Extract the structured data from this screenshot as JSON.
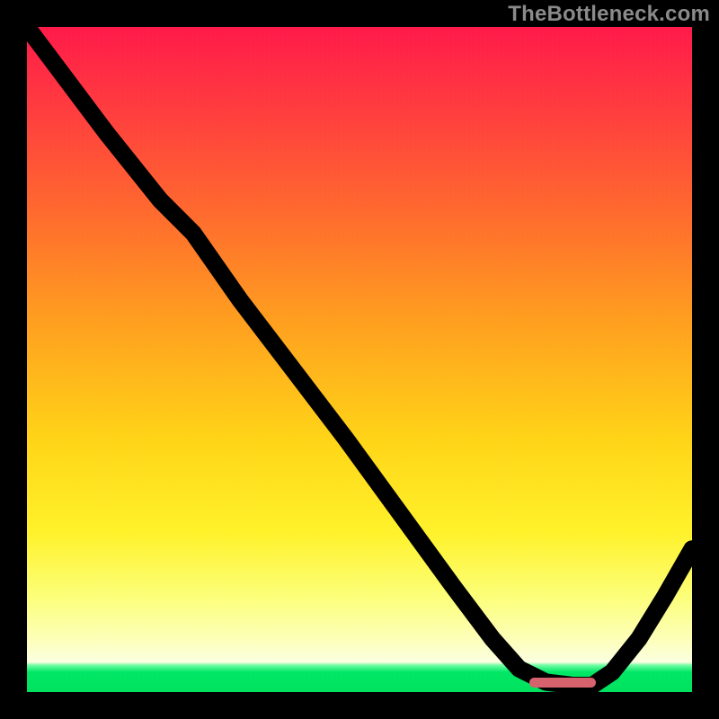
{
  "watermark": "TheBottleneck.com",
  "chart_data": {
    "type": "line",
    "title": "",
    "xlabel": "",
    "ylabel": "",
    "xlim": [
      0,
      100
    ],
    "ylim": [
      0,
      100
    ],
    "grid": false,
    "legend": false,
    "background": {
      "type": "vertical_gradient",
      "stops": [
        {
          "pos": 0.0,
          "color": "#ff1a49"
        },
        {
          "pos": 0.12,
          "color": "#ff3b3f"
        },
        {
          "pos": 0.28,
          "color": "#ff6a2e"
        },
        {
          "pos": 0.44,
          "color": "#ff9e1f"
        },
        {
          "pos": 0.62,
          "color": "#ffd417"
        },
        {
          "pos": 0.76,
          "color": "#fff22a"
        },
        {
          "pos": 0.86,
          "color": "#fcff7c"
        },
        {
          "pos": 0.92,
          "color": "#fdffb8"
        },
        {
          "pos": 0.955,
          "color": "#fbffe0"
        },
        {
          "pos": 0.96,
          "color": "#6cfca1"
        },
        {
          "pos": 1.0,
          "color": "#00e25e"
        }
      ]
    },
    "series": [
      {
        "name": "bottleneck-curve",
        "stroke": "#000000",
        "x": [
          0.0,
          6.0,
          12.0,
          20.0,
          25.0,
          32.0,
          40.0,
          48.0,
          56.0,
          64.0,
          70.0,
          74.0,
          78.0,
          82.0,
          85.0,
          88.0,
          92.0,
          96.0,
          100.0
        ],
        "y": [
          100.0,
          92.0,
          84.0,
          74.0,
          69.0,
          59.0,
          48.5,
          38.0,
          27.0,
          16.0,
          8.0,
          3.5,
          1.5,
          1.0,
          1.0,
          3.0,
          8.0,
          14.5,
          21.5
        ]
      }
    ],
    "markers": [
      {
        "name": "optimal-range",
        "shape": "rounded-bar",
        "color": "#d6626d",
        "x_start": 75.5,
        "x_end": 85.5,
        "y": 1.4
      }
    ]
  }
}
